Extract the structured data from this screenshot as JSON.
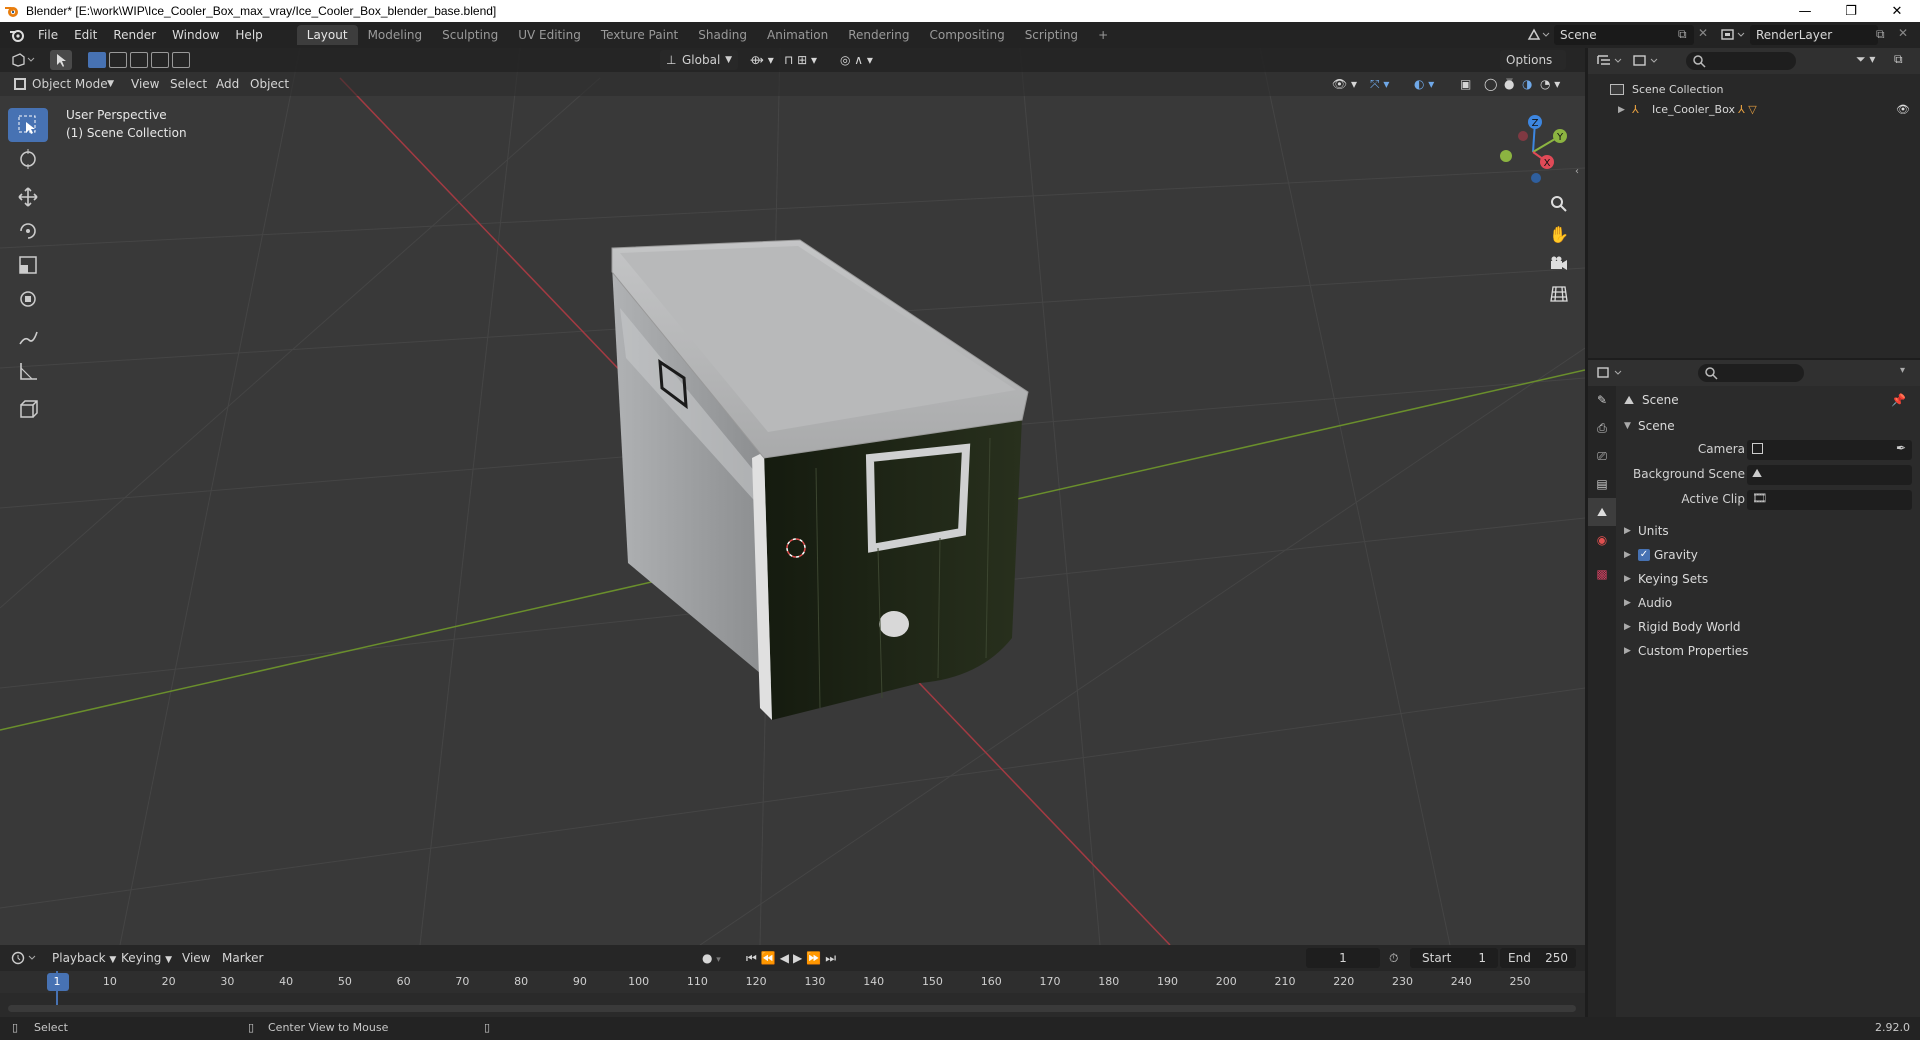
{
  "window": {
    "title": "Blender* [E:\\work\\WIP\\Ice_Cooler_Box_max_vray/Ice_Cooler_Box_blender_base.blend]",
    "controls": [
      "—",
      "❐",
      "✕"
    ]
  },
  "menu": [
    "File",
    "Edit",
    "Render",
    "Window",
    "Help"
  ],
  "workspaces": [
    {
      "label": "Layout",
      "active": true
    },
    {
      "label": "Modeling"
    },
    {
      "label": "Sculpting"
    },
    {
      "label": "UV Editing"
    },
    {
      "label": "Texture Paint"
    },
    {
      "label": "Shading"
    },
    {
      "label": "Animation"
    },
    {
      "label": "Rendering"
    },
    {
      "label": "Compositing"
    },
    {
      "label": "Scripting"
    }
  ],
  "add_workspace": "+",
  "scene_selector": {
    "value": "Scene"
  },
  "view_layer_selector": {
    "value": "RenderLayer"
  },
  "viewport": {
    "transform_orientation": "Global",
    "options": "Options",
    "mode": "Object Mode",
    "menus": [
      "View",
      "Select",
      "Add",
      "Object"
    ],
    "overlay_line1": "User Perspective",
    "overlay_line2": "(1) Scene Collection",
    "gizmo": {
      "x": "X",
      "y": "Y",
      "z": "Z"
    }
  },
  "outliner": {
    "root": "Scene Collection",
    "items": [
      {
        "label": "Ice_Cooler_Box"
      }
    ]
  },
  "properties": {
    "context": "Scene",
    "panel_title": "Scene",
    "fields": [
      {
        "label": "Camera"
      },
      {
        "label": "Background Scene"
      },
      {
        "label": "Active Clip"
      }
    ],
    "sections": [
      {
        "label": "Units"
      },
      {
        "label": "Gravity",
        "checked": true
      },
      {
        "label": "Keying Sets"
      },
      {
        "label": "Audio"
      },
      {
        "label": "Rigid Body World"
      },
      {
        "label": "Custom Properties"
      }
    ]
  },
  "timeline": {
    "menus": [
      "Playback",
      "Keying",
      "View",
      "Marker"
    ],
    "current_frame": "1",
    "start_label": "Start",
    "start_value": "1",
    "end_label": "End",
    "end_value": "250",
    "ruler": [
      "1",
      "10",
      "20",
      "30",
      "40",
      "50",
      "60",
      "70",
      "80",
      "90",
      "100",
      "110",
      "120",
      "130",
      "140",
      "150",
      "160",
      "170",
      "180",
      "190",
      "200",
      "210",
      "220",
      "230",
      "240",
      "250"
    ]
  },
  "statusbar": {
    "left": "Select",
    "middle": "Center View to Mouse",
    "version": "2.92.0"
  },
  "colors": {
    "accent": "#4772b3",
    "x_axis": "#e04a57",
    "y_axis": "#8cb441",
    "z_axis": "#3d86e0"
  }
}
